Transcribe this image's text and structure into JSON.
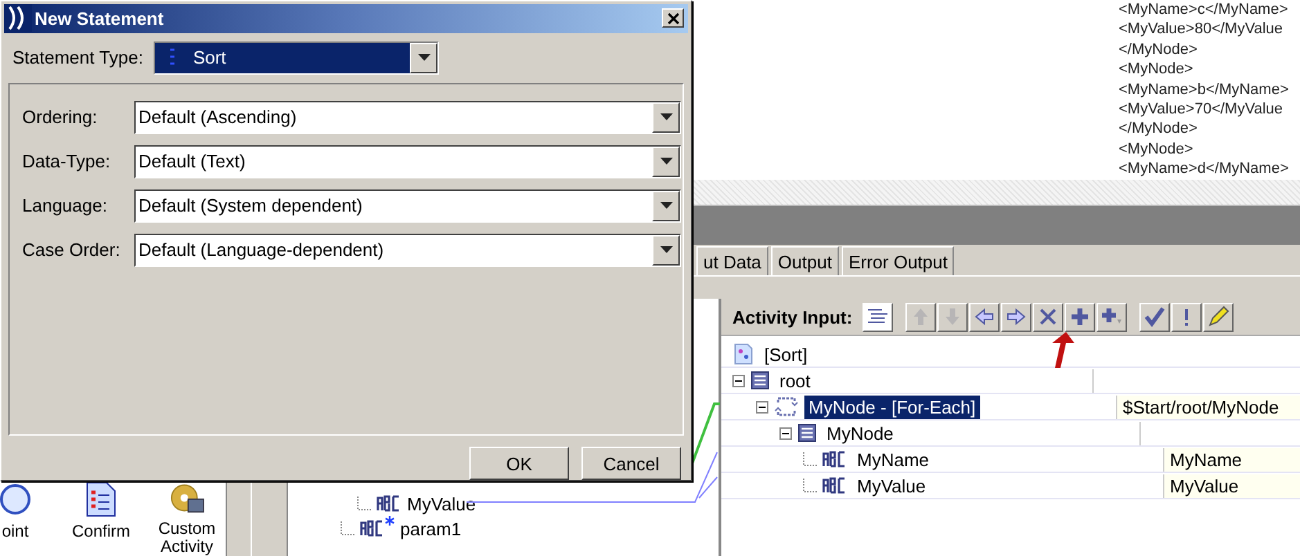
{
  "xml_view": {
    "lines": [
      "<MyName>c</MyName>",
      "<MyValue>80</MyValue",
      "</MyNode>",
      "<MyNode>",
      "<MyName>b</MyName>",
      "<MyValue>70</MyValue",
      "</MyNode>",
      "<MyNode>",
      "<MyName>d</MyName>"
    ]
  },
  "tabs": [
    {
      "label": "ut Data",
      "selected": false
    },
    {
      "label": "Output",
      "selected": false
    },
    {
      "label": "Error Output",
      "selected": false
    }
  ],
  "palette": {
    "items": [
      {
        "label": "oint",
        "kind": "circle"
      },
      {
        "label": "Confirm",
        "kind": "checklist"
      },
      {
        "label": "Custom Activity",
        "kind": "custom"
      }
    ]
  },
  "source_tree": {
    "items": [
      {
        "label": "MyValue",
        "optional": false
      },
      {
        "label": "param1",
        "optional": true
      }
    ]
  },
  "activity_input": {
    "label": "Activity Input:",
    "toolbar": [
      {
        "kind": "up",
        "disabled": true
      },
      {
        "kind": "down",
        "disabled": true
      },
      {
        "kind": "left",
        "disabled": false
      },
      {
        "kind": "right",
        "disabled": false
      },
      {
        "kind": "delete",
        "disabled": false
      },
      {
        "kind": "add",
        "disabled": false
      },
      {
        "kind": "add-child",
        "disabled": false
      },
      {
        "kind": "check",
        "disabled": false
      },
      {
        "kind": "error",
        "disabled": false
      },
      {
        "kind": "edit",
        "disabled": false
      }
    ],
    "tree": [
      {
        "label": "[Sort]",
        "kind": "schema",
        "selected": false,
        "children": [
          {
            "label": "root",
            "kind": "element",
            "expanded": true,
            "selected": false,
            "children": [
              {
                "label": "MyNode - [For-Each]",
                "kind": "loop",
                "expanded": true,
                "selected": true,
                "value": "$Start/root/MyNode",
                "children": [
                  {
                    "label": "MyNode",
                    "kind": "element",
                    "expanded": true,
                    "selected": false,
                    "children": [
                      {
                        "label": "MyName",
                        "kind": "string",
                        "selected": false,
                        "value": "MyName"
                      },
                      {
                        "label": "MyValue",
                        "kind": "string",
                        "selected": false,
                        "value": "MyValue"
                      }
                    ]
                  }
                ]
              }
            ]
          }
        ]
      }
    ]
  },
  "dialog": {
    "title": "New Statement",
    "statement_type": {
      "label": "Statement Type:",
      "value": "Sort"
    },
    "fields": [
      {
        "label": "Ordering:",
        "value": "Default (Ascending)"
      },
      {
        "label": "Data-Type:",
        "value": "Default (Text)"
      },
      {
        "label": "Language:",
        "value": "Default (System dependent)"
      },
      {
        "label": "Case Order:",
        "value": "Default (Language-dependent)"
      }
    ],
    "buttons": [
      "OK",
      "Cancel"
    ]
  }
}
